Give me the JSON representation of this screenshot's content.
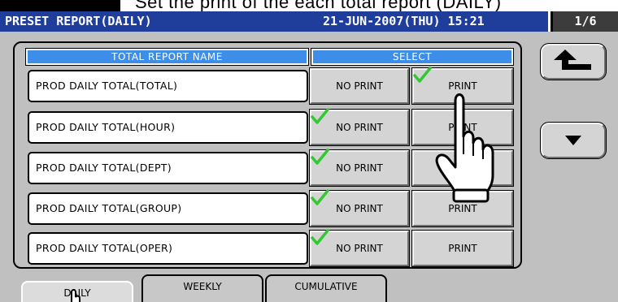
{
  "doc_fragment": "Set the print of the each total report (DAILY)",
  "header": {
    "title": "PRESET REPORT(DAILY)",
    "datetime": "21-JUN-2007(THU) 15:21",
    "page": "1/6"
  },
  "table": {
    "col_name": "TOTAL REPORT NAME",
    "col_select": "SELECT",
    "rows": [
      {
        "name": "PROD DAILY TOTAL(TOTAL)",
        "no_print": "NO PRINT",
        "print": "PRINT",
        "selected": "PRINT"
      },
      {
        "name": "PROD DAILY TOTAL(HOUR)",
        "no_print": "NO PRINT",
        "print": "PRINT",
        "selected": "NO PRINT"
      },
      {
        "name": "PROD DAILY TOTAL(DEPT)",
        "no_print": "NO PRINT",
        "print": "PRINT",
        "selected": "NO PRINT"
      },
      {
        "name": "PROD DAILY TOTAL(GROUP)",
        "no_print": "NO PRINT",
        "print": "PRINT",
        "selected": "NO PRINT"
      },
      {
        "name": "PROD DAILY TOTAL(OPER)",
        "no_print": "NO PRINT",
        "print": "PRINT",
        "selected": "NO PRINT"
      }
    ]
  },
  "tabs": {
    "daily": "DAILY",
    "weekly": "WEEKLY",
    "cumulative": "CUMULATIVE"
  },
  "icons": {
    "back": "return-arrow-icon",
    "down": "triangle-down-icon",
    "check": "check-icon",
    "hand": "pointing-hand-icon"
  },
  "colors": {
    "title_bar": "#1f3e9c",
    "header_cell": "#3d8ee8",
    "check": "#32c832",
    "panel_bg": "#c0c0c0"
  }
}
